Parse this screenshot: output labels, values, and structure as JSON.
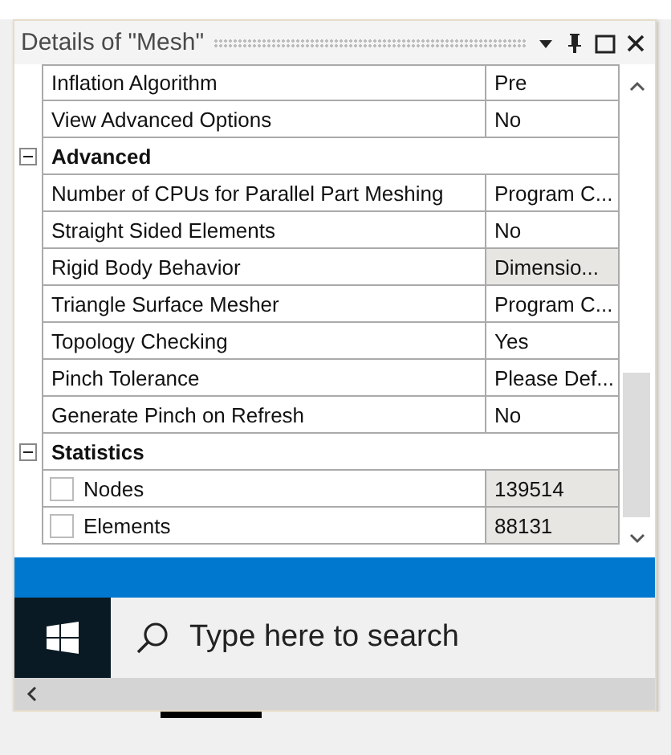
{
  "panel": {
    "title": "Details of \"Mesh\""
  },
  "groups": [
    {
      "rows": [
        {
          "label": "Inflation Algorithm",
          "value": "Pre",
          "readonly": false
        },
        {
          "label": "View Advanced Options",
          "value": "No",
          "readonly": false
        }
      ]
    },
    {
      "title": "Advanced",
      "expanded": true,
      "rows": [
        {
          "label": "Number of CPUs for Parallel Part Meshing",
          "value": "Program C...",
          "readonly": false
        },
        {
          "label": "Straight Sided Elements",
          "value": "No",
          "readonly": false
        },
        {
          "label": "Rigid Body Behavior",
          "value": "Dimensio...",
          "readonly": true
        },
        {
          "label": "Triangle Surface Mesher",
          "value": "Program C...",
          "readonly": false
        },
        {
          "label": "Topology Checking",
          "value": "Yes",
          "readonly": false
        },
        {
          "label": "Pinch Tolerance",
          "value": "Please Def...",
          "readonly": false
        },
        {
          "label": "Generate Pinch on Refresh",
          "value": "No",
          "readonly": false
        }
      ]
    },
    {
      "title": "Statistics",
      "expanded": true,
      "rows": [
        {
          "label": "Nodes",
          "value": "139514",
          "readonly": true,
          "checked": false
        },
        {
          "label": "Elements",
          "value": "88131",
          "readonly": true,
          "checked": false
        }
      ]
    }
  ],
  "taskbar": {
    "search": {
      "placeholder": "Type here to search"
    }
  }
}
